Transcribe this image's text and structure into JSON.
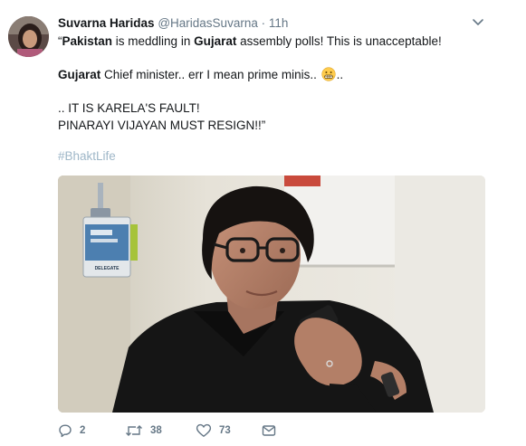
{
  "tweet": {
    "author": {
      "display_name": "Suvarna Haridas",
      "handle": "@HaridasSuvarna",
      "separator": "·",
      "time": "11h"
    },
    "line1": {
      "open_quote": "“",
      "word1": "Pakistan",
      "text1": " is meddling in ",
      "word2": "Gujarat",
      "text2": " assembly polls! This is unacceptable!"
    },
    "line2": {
      "word1": "Gujarat",
      "text1": " Chief minister.. err I mean prime minis.. ",
      "emoji_icon": "grimacing-face-icon",
      "text2": ".."
    },
    "line3": ".. IT IS KARELA'S FAULT!",
    "line4": "PINARAYI VIJAYAN MUST RESIGN!!”",
    "hashtag": "#BhaktLife",
    "media": {
      "lanyard_card_text": "DELEGATE"
    },
    "actions": {
      "reply_count": "2",
      "retweet_count": "38",
      "like_count": "73"
    },
    "colors": {
      "text": "#14171a",
      "secondary": "#657786",
      "hashtag": "#9fb7c8"
    }
  }
}
